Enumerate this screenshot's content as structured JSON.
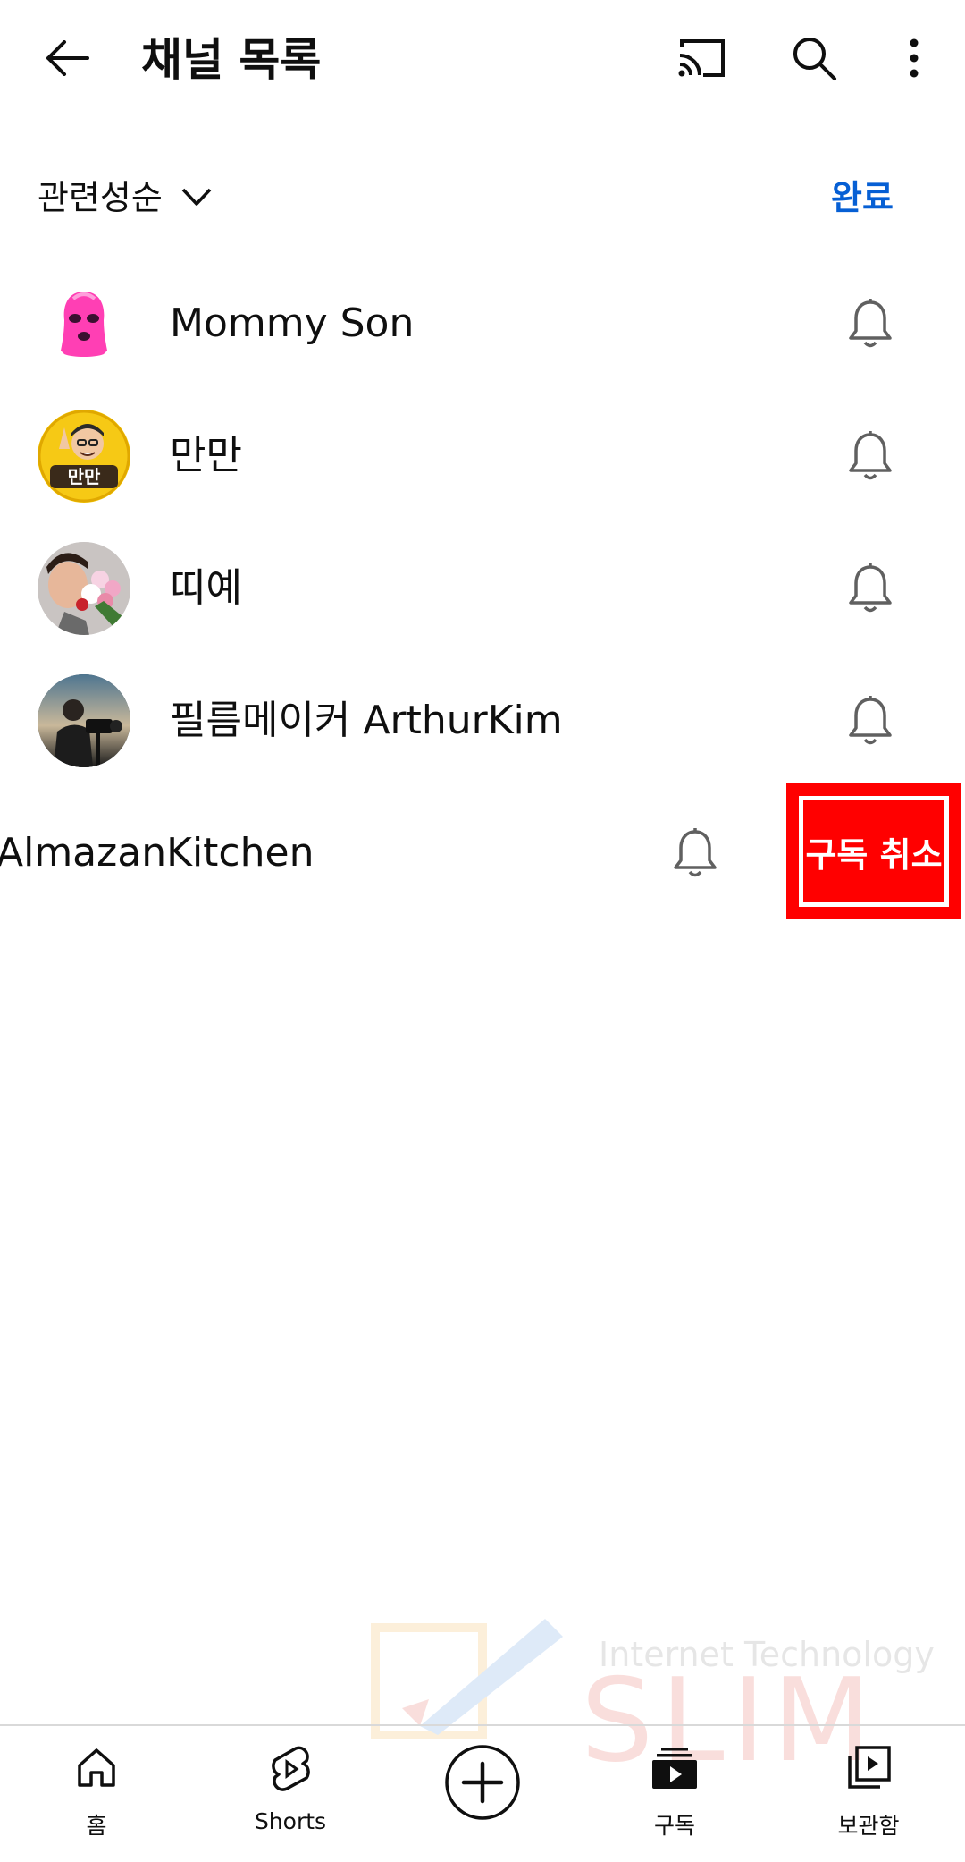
{
  "header": {
    "title": "채널 목록",
    "back_icon": "back-arrow-icon",
    "cast_icon": "cast-icon",
    "search_icon": "search-icon",
    "more_icon": "more-vertical-icon"
  },
  "sort": {
    "label": "관련성순",
    "done_label": "완료"
  },
  "channels": [
    {
      "name": "Mommy Son",
      "avatar": "pink-balaclava-avatar",
      "bell_icon": "bell-outline-icon"
    },
    {
      "name": "만만",
      "avatar": "manman-avatar",
      "bell_icon": "bell-outline-icon"
    },
    {
      "name": "띠예",
      "avatar": "flowers-avatar",
      "bell_icon": "bell-outline-icon"
    },
    {
      "name": "필름메이커 ArthurKim",
      "avatar": "filmmaker-avatar",
      "bell_icon": "bell-outline-icon"
    },
    {
      "name": "AlmazanKitchen",
      "avatar": "",
      "bell_icon": "bell-outline-icon",
      "swiped": true
    }
  ],
  "swipe_action": {
    "label": "구독 취소",
    "color": "#ff0000"
  },
  "watermark": {
    "line1": "Internet Technology",
    "line2": "SLIM"
  },
  "nav": {
    "items": [
      {
        "label": "홈",
        "icon": "home-icon"
      },
      {
        "label": "Shorts",
        "icon": "shorts-icon"
      },
      {
        "label": "",
        "icon": "create-plus-icon"
      },
      {
        "label": "구독",
        "icon": "subscriptions-icon"
      },
      {
        "label": "보관함",
        "icon": "library-icon"
      }
    ]
  },
  "colors": {
    "accent_blue": "#065fd4",
    "unsubscribe_red": "#ff0000",
    "text": "#0f0f0f"
  }
}
